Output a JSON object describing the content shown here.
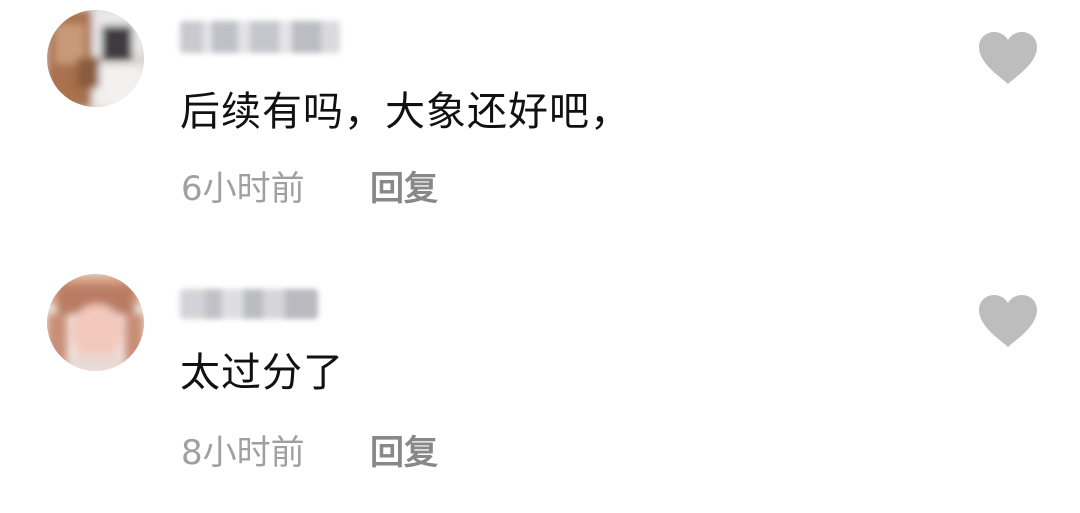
{
  "colors": {
    "background": "#ffffff",
    "comment_text": "#111111",
    "timestamp": "#a0a0a0",
    "reply": "#888888",
    "like_icon": "#bdbdbd"
  },
  "comments": [
    {
      "avatar_icon": "avatar-blurred",
      "username_icon": "username-blurred",
      "text": "后续有吗，大象还好吧，",
      "time": "6小时前",
      "reply_label": "回复",
      "like_icon": "heart-icon"
    },
    {
      "avatar_icon": "avatar-blurred",
      "username_icon": "username-blurred",
      "text": "太过分了",
      "time": "8小时前",
      "reply_label": "回复",
      "like_icon": "heart-icon"
    }
  ]
}
